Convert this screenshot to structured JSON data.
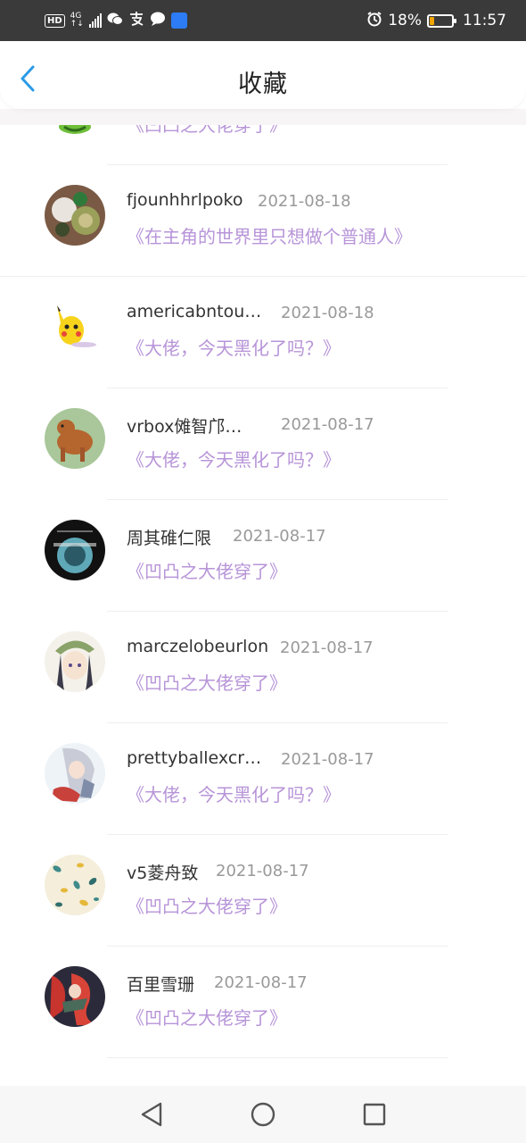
{
  "status_bar": {
    "hd": "HD",
    "network": "4G",
    "battery_percent": "18%",
    "time": "11:57",
    "battery_level": 0.18,
    "icons": [
      "hd-badge-icon",
      "signal-icon",
      "wechat-icon",
      "alipay-icon",
      "message-icon",
      "app-icon",
      "alarm-icon",
      "battery-icon"
    ]
  },
  "header": {
    "title": "收藏",
    "back_icon": "chevron-left-icon",
    "accent": "#2b9be6"
  },
  "colors": {
    "book_title": "#b794d8",
    "date": "#999999",
    "username": "#333333"
  },
  "list": {
    "items": [
      {
        "username": "",
        "date": "",
        "book": "《凹凸之大佬穿了》"
      },
      {
        "username": "fjounhhrlpoko",
        "date": "2021-08-18",
        "book": "《在主角的世界里只想做个普通人》"
      },
      {
        "username": "americabntou…",
        "date": "2021-08-18",
        "book": "《大佬，今天黑化了吗？》"
      },
      {
        "username": "vrbox傩智邝…",
        "date": "2021-08-17",
        "book": "《大佬，今天黑化了吗？》"
      },
      {
        "username": "周其碓仁限",
        "date": "2021-08-17",
        "book": "《凹凸之大佬穿了》"
      },
      {
        "username": "marczelobeurlon",
        "date": "2021-08-17",
        "book": "《凹凸之大佬穿了》"
      },
      {
        "username": "prettyballexcr…",
        "date": "2021-08-17",
        "book": "《大佬，今天黑化了吗？》"
      },
      {
        "username": "v5菱舟致",
        "date": "2021-08-17",
        "book": "《凹凸之大佬穿了》"
      },
      {
        "username": "百里雪珊",
        "date": "2021-08-17",
        "book": "《凹凸之大佬穿了》"
      }
    ]
  },
  "nav_bar": {
    "icons": [
      "back-triangle-icon",
      "home-circle-icon",
      "recents-square-icon"
    ]
  }
}
